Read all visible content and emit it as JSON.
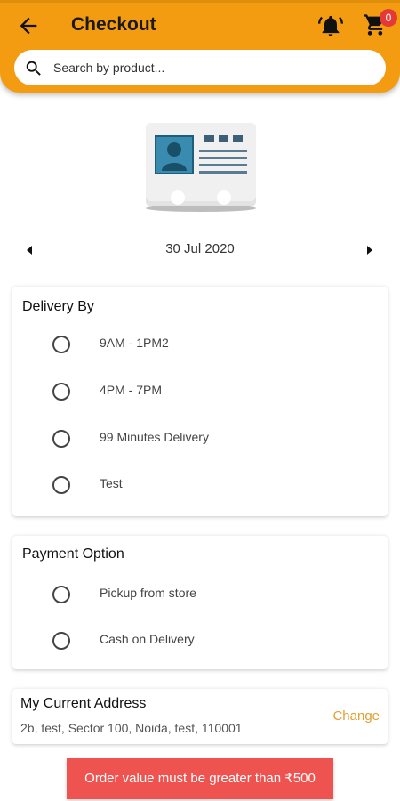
{
  "header": {
    "title": "Checkout",
    "cart_count": "0",
    "back_icon": "arrow-left-icon",
    "bell_icon": "bell-icon",
    "cart_icon": "cart-icon"
  },
  "search": {
    "placeholder": "Search by product...",
    "icon": "search-icon"
  },
  "date_selector": {
    "date": "30 Jul 2020"
  },
  "delivery": {
    "title": "Delivery By",
    "options": [
      "9AM - 1PM2",
      "4PM - 7PM",
      "99 Minutes Delivery",
      "Test"
    ]
  },
  "payment": {
    "title": "Payment Option",
    "options": [
      "Pickup from store",
      "Cash on Delivery"
    ]
  },
  "address": {
    "title": "My Current Address",
    "text": "2b, test, Sector 100, Noida, test, 110001",
    "change_label": "Change"
  },
  "warning": {
    "text": "Order value must be greater than ₹500"
  },
  "colors": {
    "accent": "#f39c12",
    "warning": "#ef5350",
    "link": "#e0a030"
  }
}
